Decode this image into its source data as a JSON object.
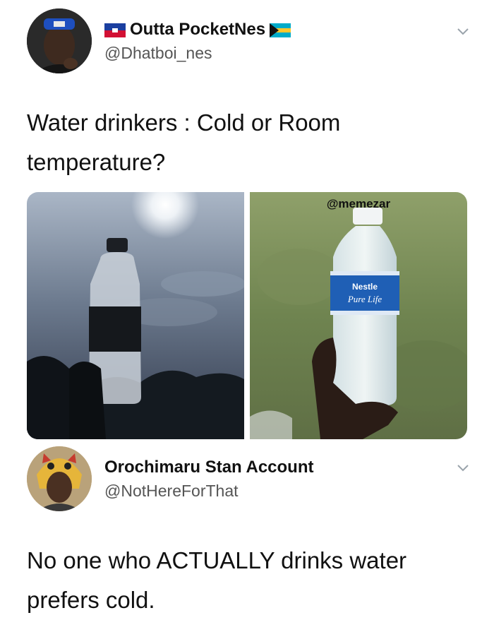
{
  "tweet1": {
    "display_name": "Outta PocketNes",
    "handle": "@Dhatboi_nes",
    "text_line1": "Water drinkers : Cold or Room",
    "text_line2": "temperature?",
    "media_watermark": "@memezar",
    "bottle_label_brand": "Nestle",
    "bottle_label_product": "Pure Life",
    "flags": [
      "haiti-flag-icon",
      "bahamas-flag-icon"
    ]
  },
  "tweet2": {
    "display_name": "Orochimaru Stan Account",
    "handle": "@NotHereForThat",
    "text_line1": "No one who ACTUALLY drinks water",
    "text_line2": "prefers cold."
  },
  "colors": {
    "text_primary": "#111111",
    "text_secondary": "#555555",
    "chevron": "#9aa3ab"
  }
}
